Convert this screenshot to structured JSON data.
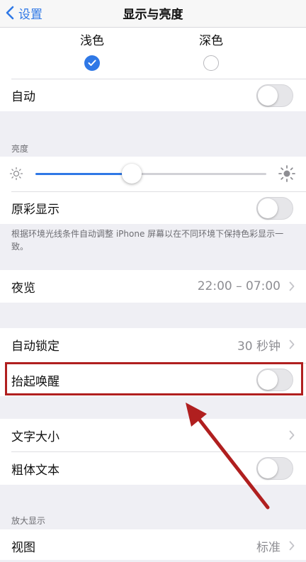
{
  "nav": {
    "back_label": "设置",
    "title": "显示与亮度"
  },
  "appearance": {
    "light_label": "浅色",
    "dark_label": "深色",
    "selected": "浅色"
  },
  "auto": {
    "label": "自动",
    "toggle_on": false
  },
  "brightness": {
    "header": "亮度",
    "level": 0.42,
    "true_tone_label": "原彩显示",
    "true_tone_on": false,
    "note": "根据环境光线条件自动调整 iPhone 屏幕以在不同环境下保持色彩显示一致。"
  },
  "night_shift": {
    "label": "夜览",
    "value": "22:00 – 07:00"
  },
  "lock": {
    "auto_lock_label": "自动锁定",
    "auto_lock_value": "30 秒钟",
    "raise_to_wake_label": "抬起唤醒",
    "raise_to_wake_on": false
  },
  "text": {
    "text_size_label": "文字大小",
    "bold_text_label": "粗体文本",
    "bold_text_on": false
  },
  "zoom": {
    "header": "放大显示",
    "view_label": "视图",
    "view_value": "标准"
  },
  "colors": {
    "accent": "#2f78e6",
    "annotation": "#b01f1f"
  }
}
